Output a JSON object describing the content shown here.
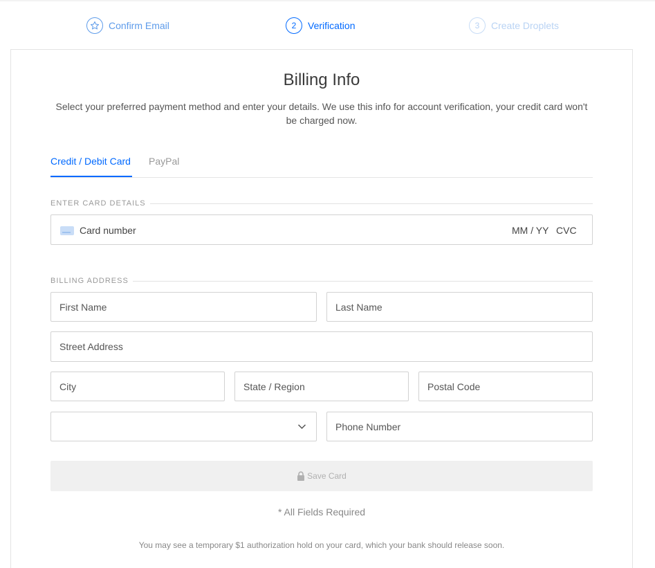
{
  "steps": [
    {
      "number": "",
      "icon": "star-icon",
      "label": "Confirm Email"
    },
    {
      "number": "2",
      "label": "Verification"
    },
    {
      "number": "3",
      "label": "Create Droplets"
    }
  ],
  "billing": {
    "title": "Billing Info",
    "subtitle": "Select your preferred payment method and enter your details. We use this info for account verification, your credit card won't be charged now."
  },
  "tabs": {
    "card": "Credit / Debit Card",
    "paypal": "PayPal"
  },
  "card_section": {
    "label": "ENTER CARD DETAILS",
    "card_number_placeholder": "Card number",
    "expiry_placeholder": "MM / YY",
    "cvc_placeholder": "CVC"
  },
  "address_section": {
    "label": "BILLING ADDRESS",
    "first_name_placeholder": "First Name",
    "last_name_placeholder": "Last Name",
    "street_placeholder": "Street Address",
    "city_placeholder": "City",
    "state_placeholder": "State / Region",
    "postal_placeholder": "Postal Code",
    "country_value": "",
    "phone_placeholder": "Phone Number"
  },
  "save_button": "Save Card",
  "required_note": "* All Fields Required",
  "authorization_note": "You may see a temporary $1 authorization hold on your card, which your bank should release soon.",
  "colors": {
    "accent": "#0069ff",
    "disabled_button_bg": "#f0f0f0"
  }
}
